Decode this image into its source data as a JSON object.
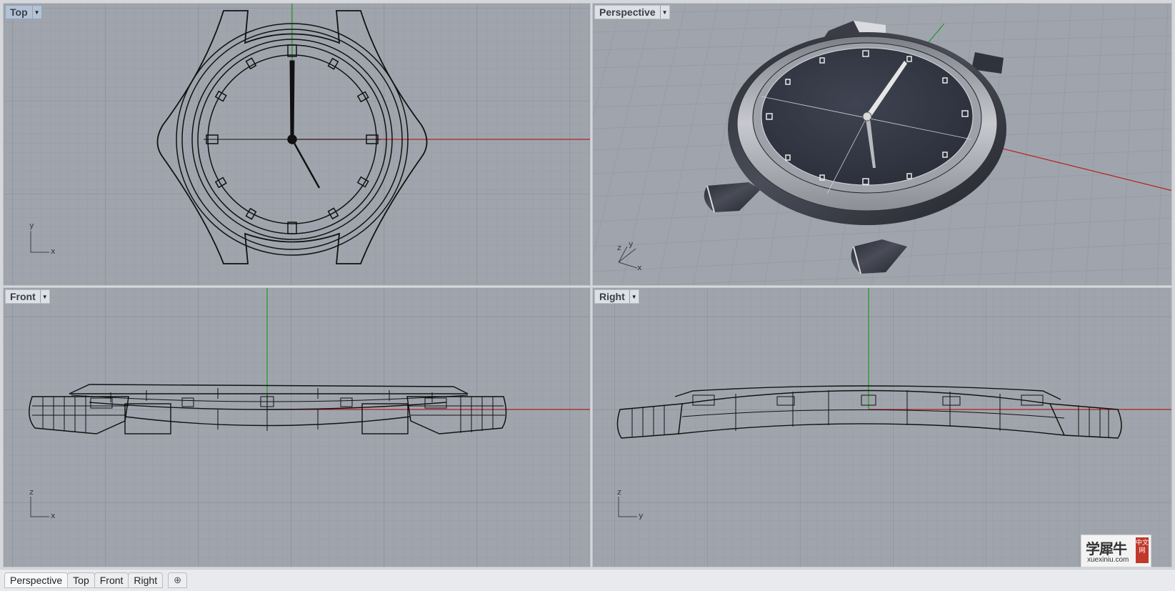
{
  "viewports": {
    "top": {
      "label": "Top",
      "axis_h": "x",
      "axis_v": "y"
    },
    "perspective": {
      "label": "Perspective",
      "axis_h": "x",
      "axis_v": "y",
      "axis_z": "z"
    },
    "front": {
      "label": "Front",
      "axis_h": "x",
      "axis_v": "z"
    },
    "right": {
      "label": "Right",
      "axis_h": "y",
      "axis_v": "z"
    }
  },
  "bottom_tabs": [
    "Perspective",
    "Top",
    "Front",
    "Right"
  ],
  "add_tab_symbol": "⊕",
  "watermark": {
    "title": "学犀牛",
    "url": "xuexiniu.com",
    "seal": "中文网"
  },
  "colors": {
    "viewport_bg": "#a0a5ad",
    "grid_minor": "#989da5",
    "grid_major": "#8a9098",
    "x_axis": "#b22222",
    "y_axis": "#1f9a1f",
    "active_tab": "#b4c2d6"
  },
  "icons": {
    "dropdown": "caret-down-icon",
    "add": "plus-circle-icon"
  }
}
